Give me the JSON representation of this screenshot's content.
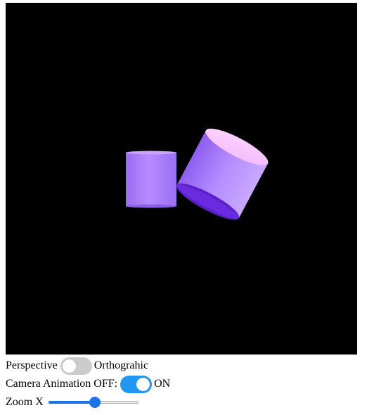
{
  "projection": {
    "left_label": "Perspective",
    "right_label": "Orthograhic",
    "is_on": false
  },
  "camera_animation": {
    "left_label": "Camera Animation OFF:",
    "right_label": "ON",
    "is_on": true
  },
  "zoom": {
    "label": "Zoom X",
    "value_fraction": 0.52
  },
  "scene": {
    "background": "#000000",
    "objects": [
      "cylinder-upright",
      "cylinder-tilted"
    ],
    "object_color": "#a77bff"
  },
  "colors": {
    "toggle_on": "#2196f3",
    "toggle_off": "#cccccc",
    "slider_accent": "#1a73e8"
  }
}
